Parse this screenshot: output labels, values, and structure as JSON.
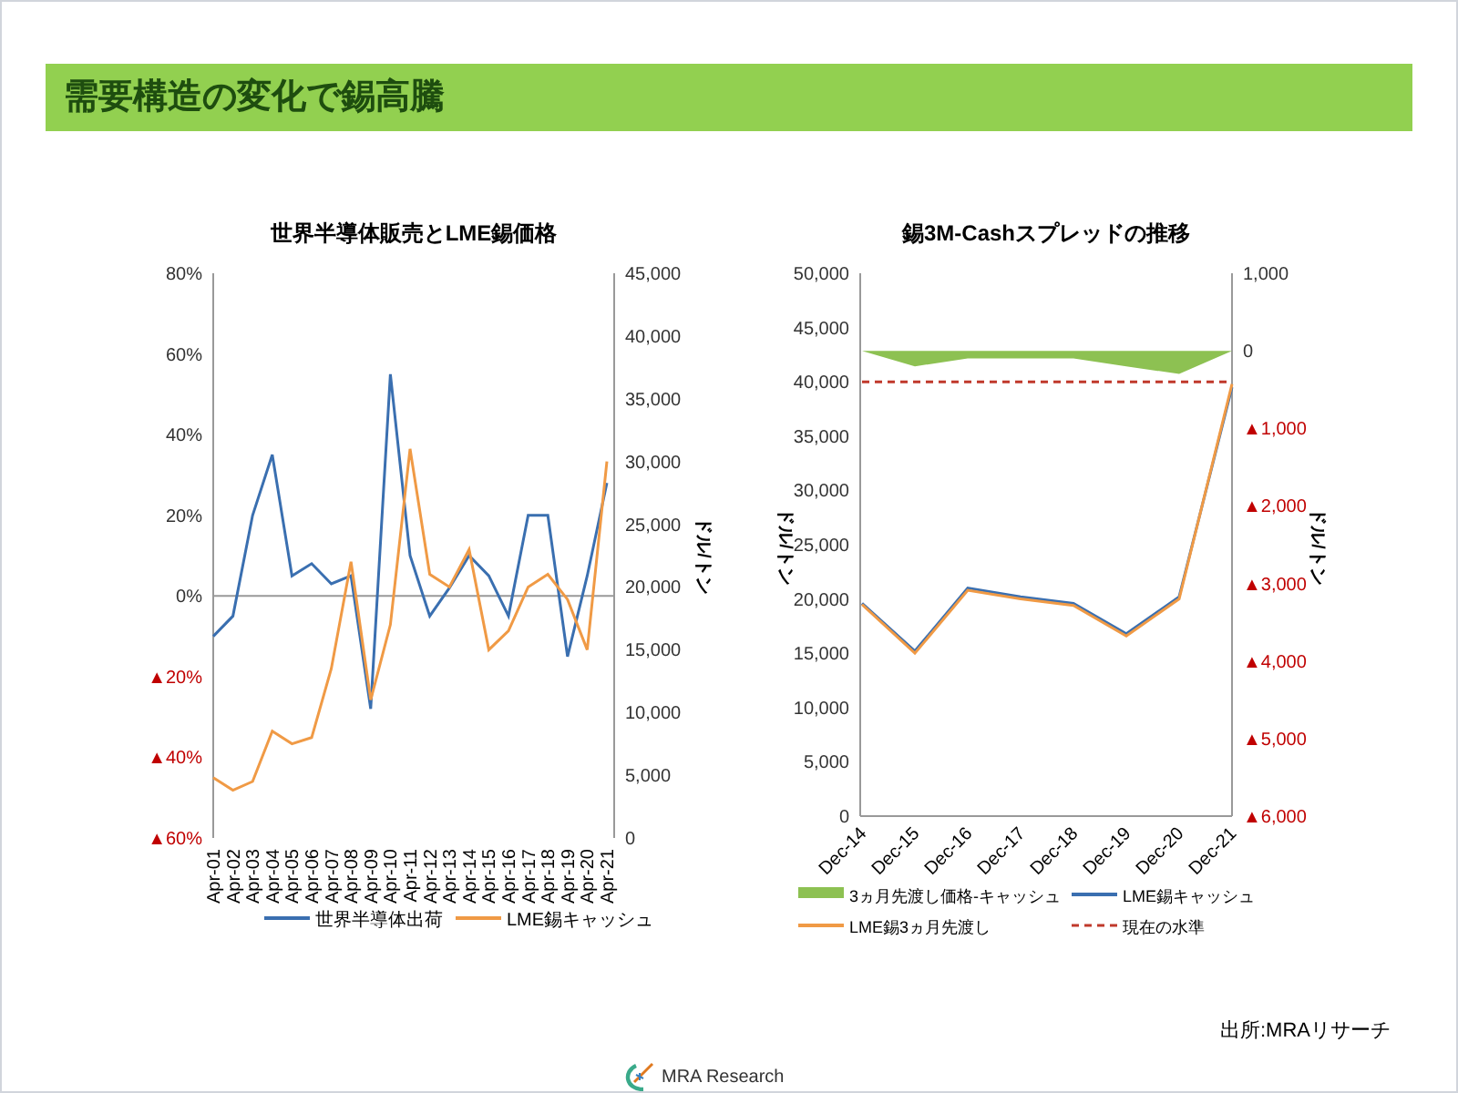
{
  "title": "需要構造の変化で錫高騰",
  "charts": [
    {
      "chart_data": {
        "type": "line",
        "title": "世界半導体販売とLME錫価格",
        "y2label": "ドル/トン",
        "categories": [
          "Apr-01",
          "Apr-02",
          "Apr-03",
          "Apr-04",
          "Apr-05",
          "Apr-06",
          "Apr-07",
          "Apr-08",
          "Apr-09",
          "Apr-10",
          "Apr-11",
          "Apr-12",
          "Apr-13",
          "Apr-14",
          "Apr-15",
          "Apr-16",
          "Apr-17",
          "Apr-18",
          "Apr-19",
          "Apr-20",
          "Apr-21"
        ],
        "ylim": [
          -60,
          80
        ],
        "y2lim": [
          0,
          45000
        ],
        "legend": "bottom",
        "yticks": [
          {
            "value": 80,
            "label": "80%"
          },
          {
            "value": 60,
            "label": "60%"
          },
          {
            "value": 40,
            "label": "40%"
          },
          {
            "value": 20,
            "label": "20%"
          },
          {
            "value": 0,
            "label": "0%"
          },
          {
            "value": -20,
            "label": "▲20%"
          },
          {
            "value": -40,
            "label": "▲40%"
          },
          {
            "value": -60,
            "label": "▲60%"
          }
        ],
        "y2ticks": [
          {
            "value": 45000,
            "label": "45,000"
          },
          {
            "value": 40000,
            "label": "40,000"
          },
          {
            "value": 35000,
            "label": "35,000"
          },
          {
            "value": 30000,
            "label": "30,000"
          },
          {
            "value": 25000,
            "label": "25,000"
          },
          {
            "value": 20000,
            "label": "20,000"
          },
          {
            "value": 15000,
            "label": "15,000"
          },
          {
            "value": 10000,
            "label": "10,000"
          },
          {
            "value": 5000,
            "label": "5,000"
          },
          {
            "value": 0,
            "label": "0"
          }
        ],
        "series": [
          {
            "name": "世界半導体出荷",
            "color": "#3a6fb0",
            "values": [
              -10,
              -5,
              20,
              35,
              5,
              8,
              3,
              5,
              -28,
              55,
              10,
              -5,
              2,
              10,
              5,
              -5,
              20,
              20,
              -15,
              5,
              28
            ]
          },
          {
            "name": "LME錫キャッシュ",
            "color": "#f09a45",
            "axis": "y2",
            "values": [
              4800,
              3800,
              4500,
              8500,
              7500,
              8000,
              13500,
              22000,
              11000,
              17000,
              31000,
              21000,
              20000,
              23000,
              15000,
              16500,
              20000,
              21000,
              19000,
              15000,
              30000
            ]
          }
        ]
      }
    },
    {
      "chart_data": {
        "type": "line",
        "title": "錫3M-Cashスプレッドの推移",
        "ylabel": "ドル/トン",
        "y2label": "ドル/トン",
        "categories": [
          "Dec-14",
          "Dec-15",
          "Dec-16",
          "Dec-17",
          "Dec-18",
          "Dec-19",
          "Dec-20",
          "Dec-21"
        ],
        "ylim": [
          0,
          50000
        ],
        "y2lim": [
          -6000,
          1000
        ],
        "yticks": [
          {
            "value": 50000,
            "label": "50,000"
          },
          {
            "value": 45000,
            "label": "45,000"
          },
          {
            "value": 40000,
            "label": "40,000"
          },
          {
            "value": 35000,
            "label": "35,000"
          },
          {
            "value": 30000,
            "label": "30,000"
          },
          {
            "value": 25000,
            "label": "25,000"
          },
          {
            "value": 20000,
            "label": "20,000"
          },
          {
            "value": 15000,
            "label": "15,000"
          },
          {
            "value": 10000,
            "label": "10,000"
          },
          {
            "value": 5000,
            "label": "5,000"
          },
          {
            "value": 0,
            "label": "0"
          }
        ],
        "y2ticks": [
          {
            "value": 1000,
            "label": "1,000"
          },
          {
            "value": 0,
            "label": "0"
          },
          {
            "value": -1000,
            "label": "▲1,000"
          },
          {
            "value": -2000,
            "label": "▲2,000"
          },
          {
            "value": -3000,
            "label": "▲3,000"
          },
          {
            "value": -4000,
            "label": "▲4,000"
          },
          {
            "value": -5000,
            "label": "▲5,000"
          },
          {
            "value": -6000,
            "label": "▲6,000"
          }
        ],
        "series": [
          {
            "name": "3ヵ月先渡し価格-キャッシュ",
            "color": "#8dc152",
            "axis": "y2",
            "type": "area",
            "values": [
              0,
              -200,
              -100,
              -100,
              -100,
              -200,
              -300,
              0
            ]
          },
          {
            "name": "LME錫キャッシュ",
            "color": "#3a6fb0",
            "values": [
              19600,
              15200,
              21000,
              20200,
              19600,
              16800,
              20200,
              39500
            ]
          },
          {
            "name": "LME錫3ヵ月先渡し",
            "color": "#f09a45",
            "values": [
              19500,
              15000,
              20800,
              20000,
              19400,
              16600,
              20000,
              39800
            ]
          },
          {
            "name": "現在の水準",
            "color": "#c0392b",
            "line_style": "dashed",
            "values": [
              40000,
              40000,
              40000,
              40000,
              40000,
              40000,
              40000,
              40000
            ]
          }
        ],
        "legend": "bottom"
      }
    }
  ],
  "source": "出所:MRAリサーチ",
  "logo": {
    "text": "MRA Research"
  }
}
